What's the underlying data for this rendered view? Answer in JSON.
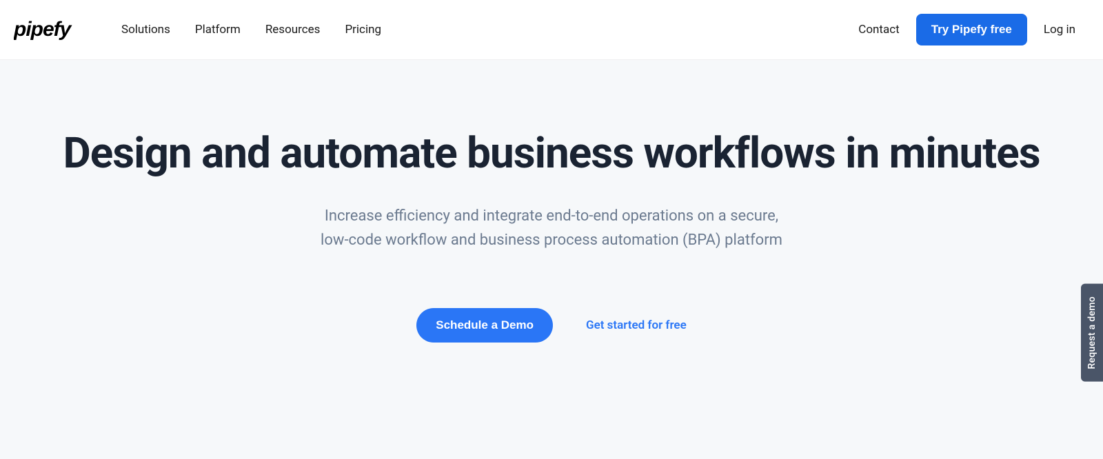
{
  "header": {
    "logo_text": "pipefy",
    "nav": {
      "solutions": "Solutions",
      "platform": "Platform",
      "resources": "Resources",
      "pricing": "Pricing"
    },
    "contact": "Contact",
    "try_free": "Try Pipefy free",
    "login": "Log in"
  },
  "hero": {
    "title": "Design and automate business workflows in minutes",
    "subtitle": "Increase efficiency and integrate end-to-end operations on a secure, low-code workflow and business process automation (BPA) platform",
    "schedule_demo": "Schedule a Demo",
    "get_started": "Get started for free"
  },
  "side_tab": {
    "label": "Request a demo"
  }
}
